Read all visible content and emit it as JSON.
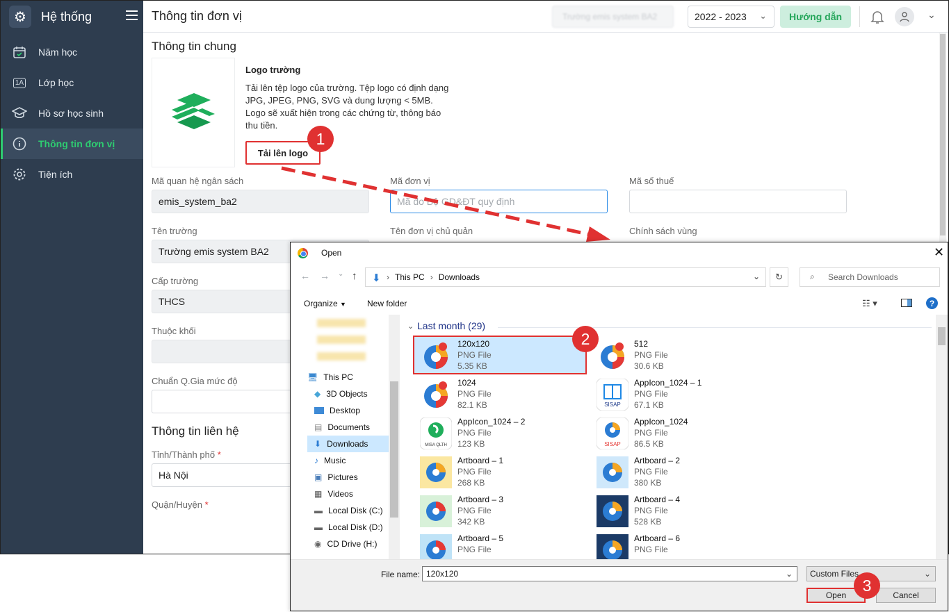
{
  "sidebar": {
    "title": "Hệ thống",
    "items": [
      {
        "label": "Năm học",
        "icon": "calendar-icon"
      },
      {
        "label": "Lớp học",
        "icon": "class-1a-icon",
        "icon_text": "1A"
      },
      {
        "label": "Hồ sơ học sinh",
        "icon": "graduation-cap-icon"
      },
      {
        "label": "Thông tin đơn vị",
        "icon": "info-icon",
        "active": true
      },
      {
        "label": "Tiện ích",
        "icon": "gear-icon"
      }
    ]
  },
  "header": {
    "title": "Thông tin đơn vị",
    "school_name_blurred": "Trường emis system BA2",
    "year": "2022 - 2023",
    "help_label": "Hướng dẫn"
  },
  "general": {
    "section_title": "Thông tin chung",
    "logo_label": "Logo trường",
    "logo_desc": "Tải lên tệp logo của trường. Tệp logo có định dạng JPG, JPEG, PNG, SVG và dung lượng < 5MB. Logo sẽ xuất hiện trong các chứng từ, thông báo thu tiền.",
    "upload_label": "Tải lên logo",
    "fields": {
      "budget_code_label": "Mã quan hệ ngân sách",
      "budget_code_value": "emis_system_ba2",
      "unit_code_label": "Mã đơn vị",
      "unit_code_placeholder": "Mã do Bộ GD&ĐT quy định",
      "tax_code_label": "Mã số thuế",
      "school_name_label": "Tên trường",
      "school_name_value": "Trường emis system BA2",
      "parent_unit_label": "Tên đơn vị chủ quản",
      "region_label": "Chính sách vùng",
      "level_label": "Cấp trường",
      "level_value": "THCS",
      "block_label": "Thuộc khối",
      "standard_label": "Chuẩn Q.Gia mức độ"
    }
  },
  "contact": {
    "section_title": "Thông tin liên hệ",
    "province_label": "Tỉnh/Thành phố",
    "province_value": "Hà Nội",
    "district_label": "Quận/Huyện",
    "required_mark": "*"
  },
  "steps": [
    "1",
    "2",
    "3"
  ],
  "dialog": {
    "title": "Open",
    "close": "✕",
    "path": [
      "This PC",
      "Downloads"
    ],
    "search_placeholder": "Search Downloads",
    "organize": "Organize",
    "new_folder": "New folder",
    "nav": [
      {
        "label": "This PC",
        "icon": "computer-icon"
      },
      {
        "label": "3D Objects",
        "icon": "cube-icon"
      },
      {
        "label": "Desktop",
        "icon": "desktop-icon"
      },
      {
        "label": "Documents",
        "icon": "document-icon"
      },
      {
        "label": "Downloads",
        "icon": "download-arrow-icon",
        "selected": true
      },
      {
        "label": "Music",
        "icon": "music-note-icon"
      },
      {
        "label": "Pictures",
        "icon": "picture-icon"
      },
      {
        "label": "Videos",
        "icon": "film-icon"
      },
      {
        "label": "Local Disk (C:)",
        "icon": "drive-icon"
      },
      {
        "label": "Local Disk (D:)",
        "icon": "drive-icon"
      },
      {
        "label": "CD Drive (H:)",
        "icon": "cd-drive-icon"
      }
    ],
    "group_header": "Last month (29)",
    "files": [
      {
        "name": "120x120",
        "type": "PNG File",
        "size": "5.35 KB",
        "thumb": "emis-logo-icon",
        "selected": true
      },
      {
        "name": "512",
        "type": "PNG File",
        "size": "30.6 KB",
        "thumb": "emis-logo-icon"
      },
      {
        "name": "1024",
        "type": "PNG File",
        "size": "82.1 KB",
        "thumb": "emis-logo-icon"
      },
      {
        "name": "AppIcon_1024 – 1",
        "type": "PNG File",
        "size": "67.1 KB",
        "thumb": "sisap-book-icon",
        "thumb_text": "SISAP"
      },
      {
        "name": "AppIcon_1024 – 2",
        "type": "PNG File",
        "size": "123 KB",
        "thumb": "misa-qlth-icon",
        "thumb_text": "MISA QLTH"
      },
      {
        "name": "AppIcon_1024",
        "type": "PNG File",
        "size": "86.5 KB",
        "thumb": "sisap-logo-icon",
        "thumb_text": "SISAP"
      },
      {
        "name": "Artboard – 1",
        "type": "PNG File",
        "size": "268 KB",
        "thumb": "artboard-yellow-icon"
      },
      {
        "name": "Artboard – 2",
        "type": "PNG File",
        "size": "380 KB",
        "thumb": "artboard-blue-icon"
      },
      {
        "name": "Artboard – 3",
        "type": "PNG File",
        "size": "342 KB",
        "thumb": "artboard-green-icon"
      },
      {
        "name": "Artboard – 4",
        "type": "PNG File",
        "size": "528 KB",
        "thumb": "artboard-navy-icon"
      },
      {
        "name": "Artboard – 5",
        "type": "PNG File",
        "size": "",
        "thumb": "artboard-sky-icon"
      },
      {
        "name": "Artboard – 6",
        "type": "PNG File",
        "size": "",
        "thumb": "artboard-navy-icon"
      }
    ],
    "file_name_label": "File name:",
    "file_name_value": "120x120",
    "file_type": "Custom Files",
    "open_label": "Open",
    "cancel_label": "Cancel"
  },
  "colors": {
    "accent": "#2ecc71",
    "sidebar": "#2e3d4f",
    "highlight": "#e03131",
    "selection": "#cce8ff"
  }
}
